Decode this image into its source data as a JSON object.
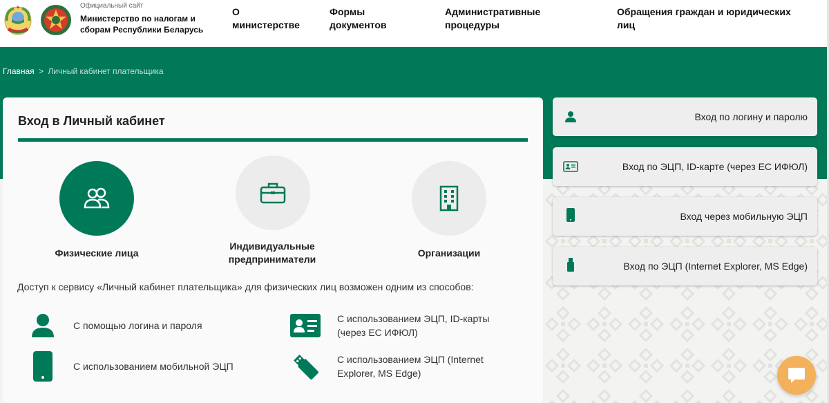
{
  "header": {
    "site_tag": "Официальный сайт",
    "site_name": "Министерство по налогам и сборам Республики Беларусь",
    "nav": [
      {
        "label": "О министерстве"
      },
      {
        "label": "Формы документов"
      },
      {
        "label": "Административные процедуры"
      },
      {
        "label": "Обращения граждан и юридических лиц"
      }
    ]
  },
  "breadcrumb": {
    "home": "Главная",
    "separator": ">",
    "current": "Личный кабинет плательщика"
  },
  "card": {
    "title": "Вход в Личный кабинет",
    "types": [
      {
        "label": "Физические лица",
        "icon": "people-icon",
        "active": true
      },
      {
        "label": "Индивидуальные предприниматели",
        "icon": "briefcase-icon",
        "active": false
      },
      {
        "label": "Организации",
        "icon": "building-icon",
        "active": false
      }
    ],
    "access_text": "Доступ к сервису «Личный кабинет плательщика» для физических лиц возможен одним из способов:",
    "methods": [
      {
        "label": "С помощью логина и пароля",
        "icon": "user-icon"
      },
      {
        "label": "С использованием ЭЦП, ID-карты (через ЕС ИФЮЛ)",
        "icon": "id-card-icon"
      },
      {
        "label": "С использованием мобильной ЭЦП",
        "icon": "mobile-phone-icon"
      },
      {
        "label": "С использованием ЭЦП (Internet Explorer, MS Edge)",
        "icon": "usb-key-icon"
      }
    ]
  },
  "login_options": [
    {
      "label": "Вход по логину и паролю",
      "icon": "user-icon"
    },
    {
      "label": "Вход по ЭЦП, ID-карте (через ЕС ИФЮЛ)",
      "icon": "id-card-icon"
    },
    {
      "label": "Вход через мобильную ЭЦП",
      "icon": "mobile-phone-icon"
    },
    {
      "label": "Вход по ЭЦП (Internet Explorer, MS Edge)",
      "icon": "usb-key-icon"
    }
  ],
  "colors": {
    "brand_green": "#007958",
    "chat_orange": "#f2b15a",
    "light_gray": "#ececec"
  }
}
